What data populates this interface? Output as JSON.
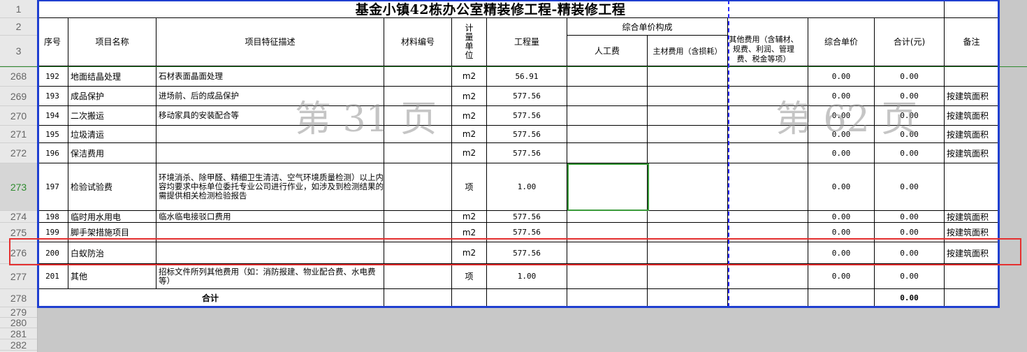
{
  "sheet": {
    "title": "基金小镇42栋办公室精装修工程-精装修工程",
    "headers": {
      "seq": "序号",
      "name": "项目名称",
      "desc": "项目特征描述",
      "material": "材料编号",
      "unit": "计量单位",
      "qty": "工程量",
      "group": "综合单价构成",
      "labor": "人工费",
      "main_material": "主材费用（含损耗）",
      "other": "其他费用（含辅材、规费、利润、管理费、税金等项）",
      "unit_price": "综合单价",
      "total": "合计(元)",
      "note": "备注"
    },
    "filter_glyph": "▾",
    "rows": [
      {
        "rownum": "268",
        "seq": "192",
        "name": "地面结晶处理",
        "desc": "石材表面晶面处理",
        "unit": "m2",
        "qty": "56.91",
        "unit_price": "0.00",
        "total": "0.00",
        "note": ""
      },
      {
        "rownum": "269",
        "seq": "193",
        "name": "成品保护",
        "desc": "进场前、后的成品保护",
        "unit": "m2",
        "qty": "577.56",
        "unit_price": "0.00",
        "total": "0.00",
        "note": "按建筑面积"
      },
      {
        "rownum": "270",
        "seq": "194",
        "name": "二次搬运",
        "desc": "移动家具的安装配合等",
        "unit": "m2",
        "qty": "577.56",
        "unit_price": "0.00",
        "total": "0.00",
        "note": "按建筑面积"
      },
      {
        "rownum": "271",
        "seq": "195",
        "name": "垃圾清运",
        "desc": "",
        "unit": "m2",
        "qty": "577.56",
        "unit_price": "0.00",
        "total": "0.00",
        "note": "按建筑面积"
      },
      {
        "rownum": "272",
        "seq": "196",
        "name": "保洁费用",
        "desc": "",
        "unit": "m2",
        "qty": "577.56",
        "unit_price": "0.00",
        "total": "0.00",
        "note": "按建筑面积"
      },
      {
        "rownum": "273",
        "seq": "197",
        "name": "检验试验费",
        "desc": "环境消杀、除甲醛、精细卫生清洁、空气环境质量检测）以上内容均要求中标单位委托专业公司进行作业，如涉及到检测结果的需提供相关检测检验报告",
        "unit": "项",
        "qty": "1.00",
        "unit_price": "0.00",
        "total": "0.00",
        "note": ""
      },
      {
        "rownum": "274",
        "seq": "198",
        "name": "临时用水用电",
        "desc": "临水临电接驳口费用",
        "unit": "m2",
        "qty": "577.56",
        "unit_price": "0.00",
        "total": "0.00",
        "note": "按建筑面积"
      },
      {
        "rownum": "275",
        "seq": "199",
        "name": "脚手架措施项目",
        "desc": "",
        "unit": "m2",
        "qty": "577.56",
        "unit_price": "0.00",
        "total": "0.00",
        "note": "按建筑面积"
      },
      {
        "rownum": "276",
        "seq": "200",
        "name": "白蚁防治",
        "desc": "",
        "unit": "m2",
        "qty": "577.56",
        "unit_price": "0.00",
        "total": "0.00",
        "note": "按建筑面积"
      },
      {
        "rownum": "277",
        "seq": "201",
        "name": "其他",
        "desc": "招标文件所列其他费用（如：消防报建、物业配合费、水电费等）",
        "unit": "项",
        "qty": "1.00",
        "unit_price": "0.00",
        "total": "0.00",
        "note": ""
      }
    ],
    "sum_row": {
      "rownum": "278",
      "label": "合计",
      "total": "0.00"
    },
    "top_rownums": [
      "1",
      "2",
      "3"
    ],
    "extra_rownums": [
      "279",
      "280",
      "281",
      "282"
    ],
    "watermarks": [
      "第 31 页",
      "第 62 页"
    ],
    "colors": {
      "selection": "#3a9b3a",
      "highlight": "#e53030",
      "print_border": "#1f3fd0",
      "page_break": "#2a2aff",
      "active_rownum": "#2e8b2e"
    }
  }
}
